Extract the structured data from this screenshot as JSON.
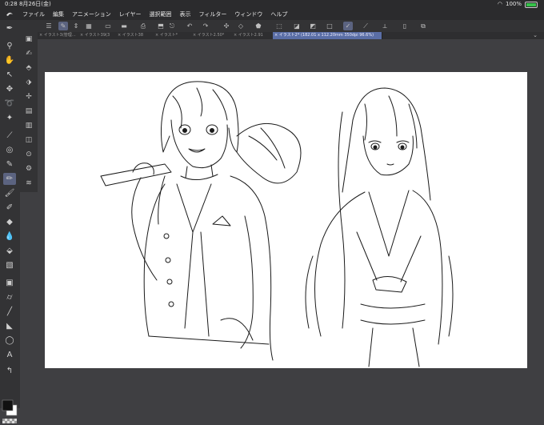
{
  "status": {
    "time_date": "0:28  8月26日(金)",
    "wifi_icon": "wifi-icon",
    "battery_text": "100%",
    "battery_level": 1.0
  },
  "menu": [
    "ファイル",
    "編集",
    "アニメーション",
    "レイヤー",
    "選択範囲",
    "表示",
    "フィルター",
    "ウィンドウ",
    "ヘルプ"
  ],
  "tabs": [
    {
      "label": "× イラスト3(管理…"
    },
    {
      "label": "× イラスト39(3"
    },
    {
      "label": "× イラスト38"
    },
    {
      "label": "× イラスト*"
    },
    {
      "label": "× イラスト2.50*"
    },
    {
      "label": "× イラスト2.91"
    },
    {
      "label": "× イラスト2* (182.01 x 112.20mm 350dpi 96.6%)"
    }
  ],
  "colors": {
    "main": "#111111",
    "sub": "#ffffff",
    "accent": "#5b6380",
    "tab_active": "#5a6ea6"
  }
}
